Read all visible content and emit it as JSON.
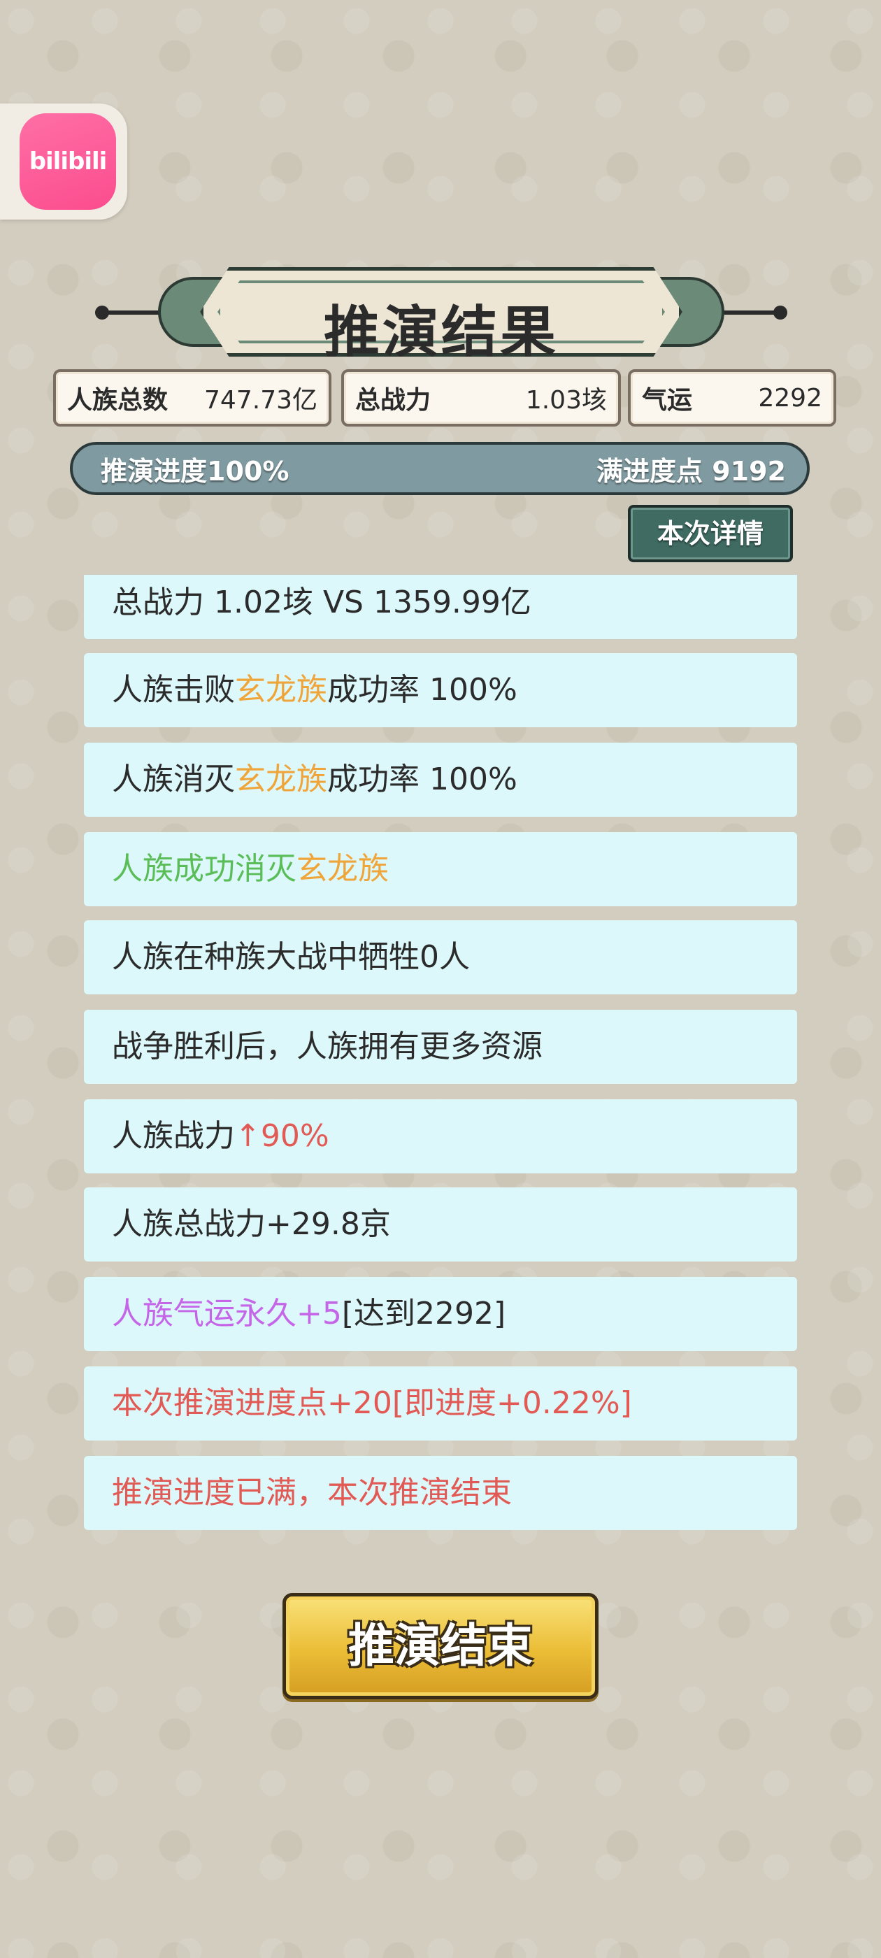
{
  "app": {
    "badge_text": "bilibili"
  },
  "title": "推演结果",
  "stats": {
    "population_label": "人族总数",
    "population_value": "747.73亿",
    "power_label": "总战力",
    "power_value": "1.03垓",
    "luck_label": "气运",
    "luck_value": "2292"
  },
  "progress": {
    "left_text": "推演进度100%",
    "right_text": "满进度点 9192"
  },
  "detail_button": "本次详情",
  "results": [
    {
      "parts": [
        {
          "text": "总战力 1.02垓 VS 1359.99亿",
          "color": "dark"
        }
      ]
    },
    {
      "parts": [
        {
          "text": "人族击败",
          "color": "dark"
        },
        {
          "text": "玄龙族",
          "color": "orange"
        },
        {
          "text": "成功率 100%",
          "color": "dark"
        }
      ]
    },
    {
      "parts": [
        {
          "text": "人族消灭",
          "color": "dark"
        },
        {
          "text": "玄龙族",
          "color": "orange"
        },
        {
          "text": "成功率 100%",
          "color": "dark"
        }
      ]
    },
    {
      "parts": [
        {
          "text": "人族成功消灭",
          "color": "green"
        },
        {
          "text": "玄龙族",
          "color": "orange"
        }
      ]
    },
    {
      "parts": [
        {
          "text": "人族在种族大战中牺牲0人",
          "color": "dark"
        }
      ]
    },
    {
      "parts": [
        {
          "text": "战争胜利后，人族拥有更多资源",
          "color": "dark"
        }
      ]
    },
    {
      "parts": [
        {
          "text": "人族战力",
          "color": "dark"
        },
        {
          "text": "↑90%",
          "color": "red"
        }
      ]
    },
    {
      "parts": [
        {
          "text": "人族总战力+29.8京",
          "color": "dark"
        }
      ]
    },
    {
      "parts": [
        {
          "text": "人族气运永久+5",
          "color": "purple"
        },
        {
          "text": "[达到2292]",
          "color": "dark"
        }
      ]
    },
    {
      "parts": [
        {
          "text": "本次推演进度点+20[即进度+0.22%]",
          "color": "red"
        }
      ]
    },
    {
      "parts": [
        {
          "text": "推演进度已满，本次推演结束",
          "color": "red"
        }
      ]
    }
  ],
  "end_button": "推演结束",
  "colors": {
    "orange": "#f0a53b",
    "green": "#5bbd58",
    "red": "#e25a55",
    "purple": "#c565e8",
    "row_bg": "#dcf8fa",
    "button_gold": "#ebbd36"
  }
}
